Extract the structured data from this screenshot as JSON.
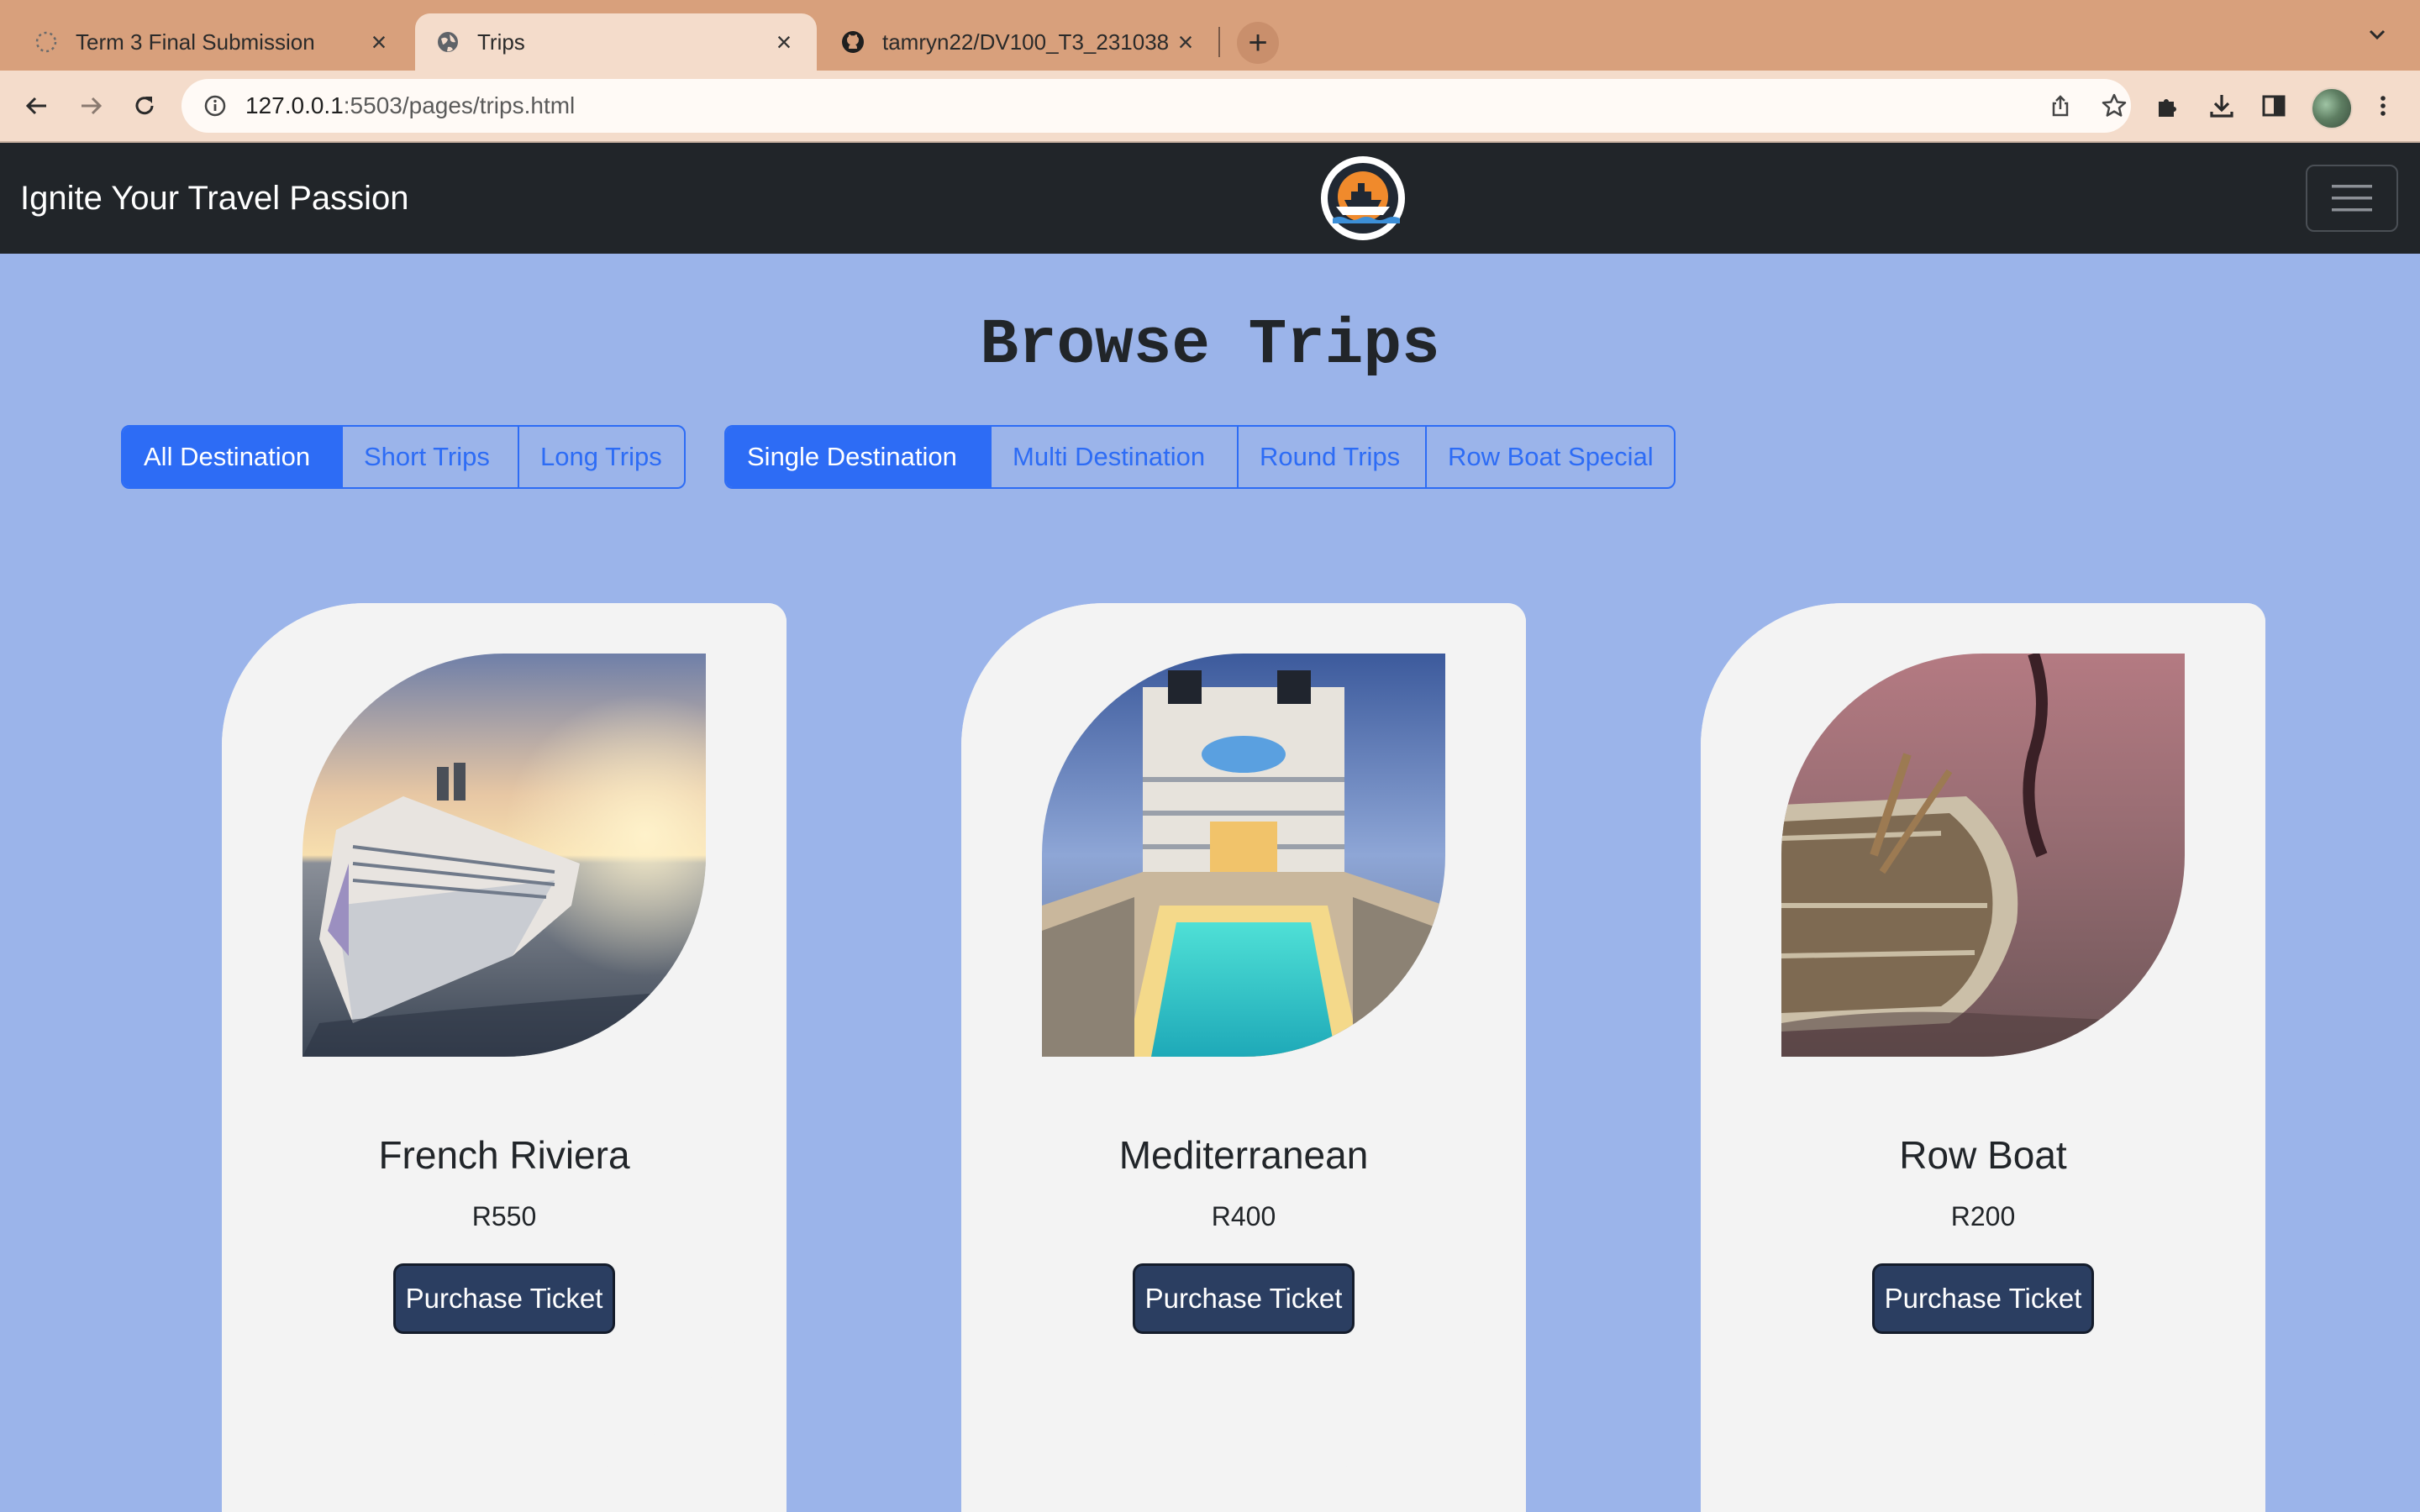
{
  "browser": {
    "tabs": [
      {
        "title": "Term 3 Final Submission",
        "favicon": "loading-spinner-icon",
        "active": false
      },
      {
        "title": "Trips",
        "favicon": "globe-icon",
        "active": true
      },
      {
        "title": "tamryn22/DV100_T3_231038",
        "favicon": "github-icon",
        "active": false
      }
    ],
    "close_glyph": "×",
    "new_tab_glyph": "+",
    "url_host": "127.0.0.1",
    "url_path": ":5503/pages/trips.html"
  },
  "site": {
    "brand": "Ignite Your Travel Passion",
    "logo": "cruise-ship-logo",
    "page_title": "Browse Trips",
    "filters_duration": [
      {
        "label": "All Destination",
        "active": true
      },
      {
        "label": "Short Trips",
        "active": false
      },
      {
        "label": "Long Trips",
        "active": false
      }
    ],
    "filters_type": [
      {
        "label": "Single Destination",
        "active": true
      },
      {
        "label": "Multi Destination",
        "active": false
      },
      {
        "label": "Round Trips",
        "active": false
      },
      {
        "label": "Row Boat Special",
        "active": false
      }
    ],
    "trips": [
      {
        "name": "French Riviera",
        "price": "R550",
        "button": "Purchase Ticket",
        "image": "cruise-ship-at-sunset"
      },
      {
        "name": "Mediterranean",
        "price": "R400",
        "button": "Purchase Ticket",
        "image": "cruise-ship-pool-deck"
      },
      {
        "name": "Row Boat",
        "price": "R200",
        "button": "Purchase Ticket",
        "image": "wooden-row-boat-on-water"
      }
    ]
  },
  "colors": {
    "page_bg": "#9bb4ea",
    "navbar_bg": "#212529",
    "primary": "#2d6cf5",
    "purchase_button": "#2b3e61",
    "card_bg": "#f3f3f3",
    "tab_strip": "#d8a07c"
  }
}
